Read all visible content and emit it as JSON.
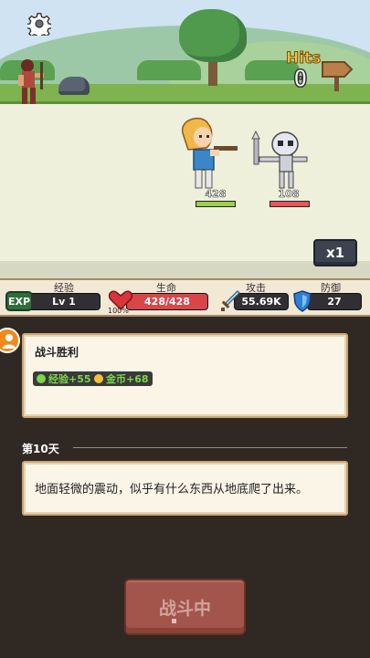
{
  "scene": {
    "hits_label": "Hits",
    "hits_count": "0",
    "hero_hp": "428",
    "enemy_hp": "108",
    "speed_label": "x1",
    "hero_hp_fraction": 1.0,
    "enemy_hp_fraction": 1.0
  },
  "stats": {
    "exp": {
      "title": "经验",
      "badge": "EXP",
      "level": "Lv 1",
      "fill_fraction": 0.05
    },
    "life": {
      "title": "生命",
      "value": "428/428",
      "percent": "100%",
      "fill_fraction": 1.0
    },
    "attack": {
      "title": "攻击",
      "value": "55.69K"
    },
    "defense": {
      "title": "防御",
      "value": "27"
    }
  },
  "log": {
    "victory_title": "战斗胜利",
    "rewards": [
      {
        "label": "经验+55",
        "color": "#7bd64a"
      },
      {
        "label": "金币+68",
        "color": "#f2c23a"
      }
    ],
    "day_label": "第10天",
    "event_text": "地面轻微的震动，似乎有什么东西从地底爬了出来。"
  },
  "fight_button": {
    "label": "战斗中"
  },
  "colors": {
    "hero_hp_bar": "#9bd04a",
    "enemy_hp_bar": "#e8555a",
    "exp_bar": "#3fae3c",
    "life_bar": "#d9464a",
    "button": "#a3554b"
  }
}
